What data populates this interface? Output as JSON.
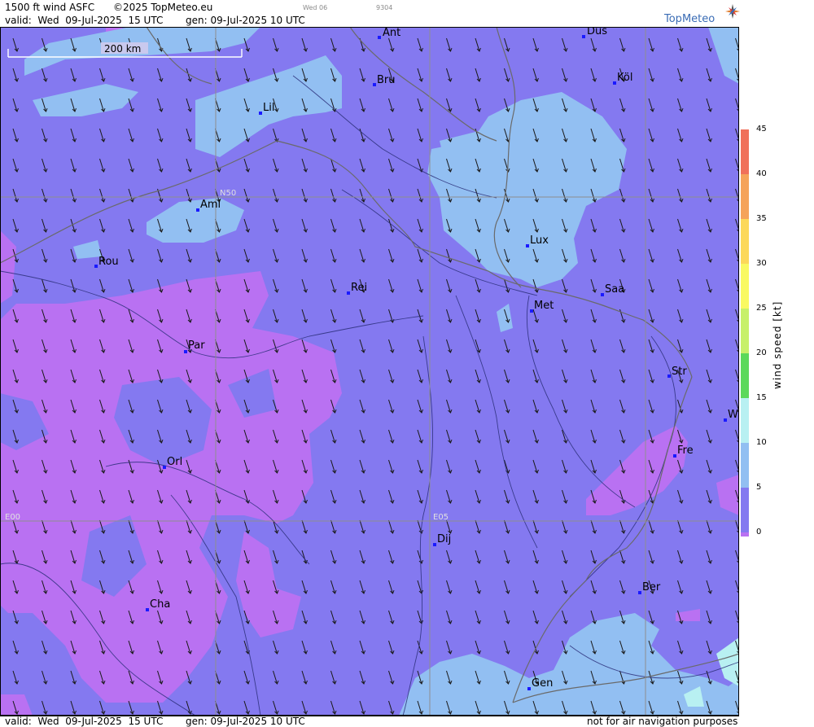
{
  "header": {
    "product": "1500 ft wind ASFC",
    "copyright": "©2025 TopMeteo.eu",
    "run_small": "Wed 06",
    "code_small": "9304",
    "valid": "valid:  Wed  09-Jul-2025  15 UTC",
    "gen": "gen: 09-Jul-2025 10 UTC",
    "logo": "TopMeteo"
  },
  "footer": {
    "valid": "valid:  Wed  09-Jul-2025  15 UTC",
    "gen": "gen: 09-Jul-2025 10 UTC",
    "disclaimer": "not for air navigation purposes"
  },
  "map": {
    "scale_label": "200 km",
    "grid_labels": {
      "lat": "N50",
      "lon_left": "E00",
      "lon_right": "E05"
    },
    "cities": [
      "Ant",
      "Düs",
      "Köl",
      "Bru",
      "Lil",
      "Ami",
      "Rou",
      "Lux",
      "Rei",
      "Saa",
      "Met",
      "Par",
      "Str",
      "W",
      "Fre",
      "Orl",
      "Dij",
      "Ber",
      "Cha",
      "Gen"
    ],
    "wind_direction": "from north-north-west",
    "colors": {
      "band_0_5": "#b971f2",
      "band_5_10": "#8479f0",
      "band_10_15": "#92bff2",
      "band_15_20": "#b8f0f2"
    }
  },
  "legend": {
    "title": "wind  speed  [kt]",
    "ticks": [
      "45",
      "40",
      "35",
      "30",
      "25",
      "20",
      "15",
      "10",
      "5",
      "0"
    ],
    "colors": [
      "#f0705a",
      "#f5a35a",
      "#fcd85a",
      "#f9f962",
      "#c7f06a",
      "#5bd95b",
      "#b8f0f2",
      "#92bff2",
      "#8479f0",
      "#b971f2"
    ]
  }
}
